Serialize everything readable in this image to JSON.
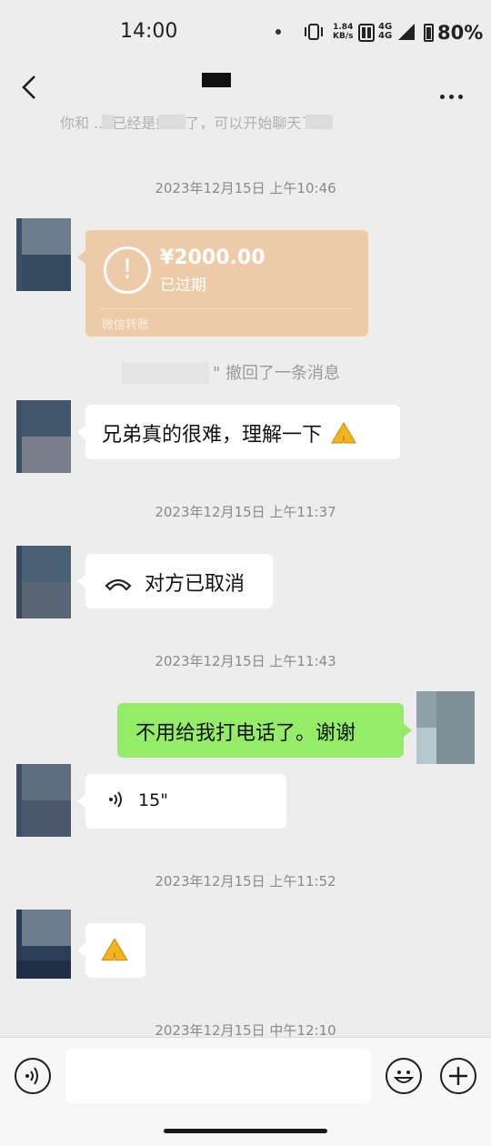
{
  "status_bar": {
    "time": "14:00",
    "speed_value": "1.84",
    "speed_unit": "KB/s",
    "net1": "4G",
    "net2": "4G",
    "battery": "80%"
  },
  "header": {
    "title": ""
  },
  "system_notice": "你和 ... 已经是好友了，可以开始聊天了。",
  "messages": {
    "ts1": "2023年12月15日 上午10:46",
    "transfer_amount": "¥2000.00",
    "transfer_status": "已过期",
    "transfer_label": "微信转账",
    "recall_text": "\" 撤回了一条消息",
    "msg1": "兄弟真的很难，理解一下",
    "ts2": "2023年12月15日 上午11:37",
    "call_cancel": "对方已取消",
    "ts3": "2023年12月15日 上午11:43",
    "msg_self": "不用给我打电话了。谢谢",
    "voice_duration": "15\"",
    "ts4": "2023年12月15日 上午11:52",
    "ts5": "2023年12月15日 中午12:10"
  },
  "icons": {
    "back": "back-arrow-icon",
    "more": "more-icon",
    "voice": "voice-icon",
    "emoji": "emoji-icon",
    "plus": "plus-icon",
    "praying": "praying-hands-emoji"
  }
}
